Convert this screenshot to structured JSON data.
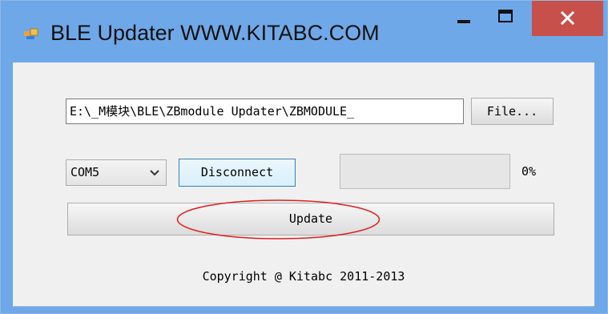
{
  "window": {
    "title": "BLE Updater WWW.KITABC.COM",
    "icon": "app-window-icon",
    "controls": [
      "minimize-icon",
      "maximize-icon",
      "close-icon"
    ],
    "close_color": "#c7504b",
    "titlebar_color": "#6fa8e8"
  },
  "file_row": {
    "path_value": "E:\\_M模块\\BLE\\ZBmodule Updater\\ZBMODULE_",
    "file_button_label": "File..."
  },
  "connect_row": {
    "port_selected": "COM5",
    "disconnect_label": "Disconnect",
    "progress_fraction": 0,
    "progress_text": "0%"
  },
  "update_button_label": "Update",
  "annotation": {
    "shape": "ellipse",
    "color": "#e02020"
  },
  "footer": {
    "copyright": "Copyright @ Kitabc 2011-2013"
  }
}
